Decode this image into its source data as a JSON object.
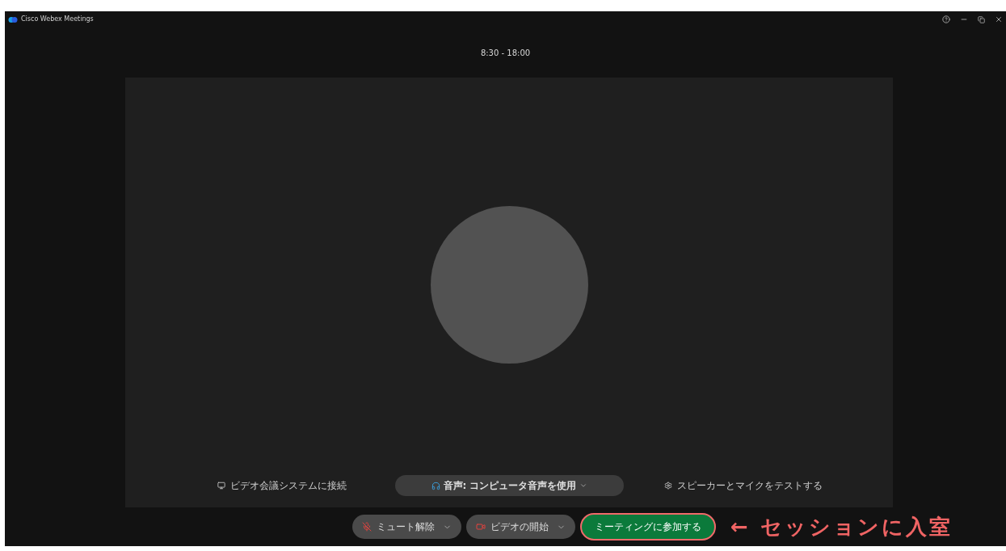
{
  "window": {
    "title": "Cisco Webex Meetings"
  },
  "meeting_time": "8:30 - 18:00",
  "preview": {
    "connect_link": "ビデオ会議システムに接続",
    "audio_selector": "音声: コンピュータ音声を使用",
    "test_link": "スピーカーとマイクをテストする"
  },
  "controls": [
    {
      "kind": "mic",
      "label": "ミュート解除"
    },
    {
      "kind": "video",
      "label": "ビデオの開始"
    },
    {
      "kind": "join",
      "label": "ミーティングに参加する"
    }
  ],
  "annotation": "← セッションに入室"
}
